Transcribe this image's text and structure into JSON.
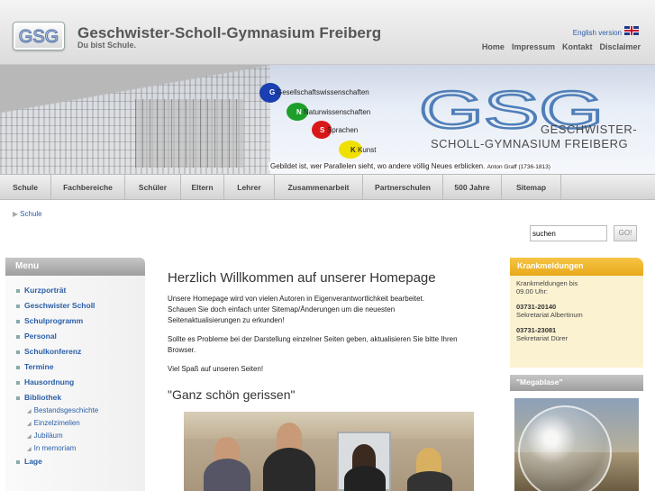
{
  "header": {
    "logo_text": "GSG",
    "title": "Geschwister-Scholl-Gymnasium Freiberg",
    "subtitle": "Du bist Schule.",
    "english_link": "English version",
    "top_links": [
      "Home",
      "Impressum",
      "Kontakt",
      "Disclaimer"
    ]
  },
  "banner": {
    "subjects": [
      "Gesellschaftswissenschaften",
      "Naturwissenschaften",
      "Sprachen",
      "Kunst"
    ],
    "subject_letters": [
      "G",
      "N",
      "S",
      "K"
    ],
    "subject_colors": [
      "#1a3fb0",
      "#1e9e2a",
      "#d81818",
      "#f0e000"
    ],
    "logo_letters": "GSG",
    "logo_line1": "GESCHWISTER-",
    "logo_line2": "SCHOLL-GYMNASIUM FREIBERG",
    "quote": "Gebildet ist, wer Parallelen sieht, wo andere völlig Neues erblicken.",
    "quote_author": "Anton Graff (1736-1813)"
  },
  "nav": [
    "Schule",
    "Fachbereiche",
    "Schüler",
    "Eltern",
    "Lehrer",
    "Zusammenarbeit",
    "Partnerschulen",
    "500 Jahre",
    "Sitemap"
  ],
  "breadcrumb": "Schule",
  "search": {
    "value": "suchen",
    "button": "GO!"
  },
  "menu": {
    "title": "Menu",
    "items": [
      "Kurzporträt",
      "Geschwister Scholl",
      "Schulprogramm",
      "Personal",
      "Schulkonferenz",
      "Termine",
      "Hausordnung",
      "Bibliothek"
    ],
    "subitems": [
      "Bestandsgeschichte",
      "Einzelzimelien",
      "Jubiläum",
      "In memoriam"
    ],
    "last_item": "Lage"
  },
  "main": {
    "title": "Herzlich Willkommen auf unserer Homepage",
    "para1_line1": "Unsere Homepage wird von vielen Autoren in Eigenverantwortlichkeit bearbeitet.",
    "para1_line2": "Schauen Sie doch einfach unter Sitemap/Änderungen um die neuesten",
    "para1_line3": "Seitenaktualisierungen zu erkunden!",
    "para2_line1": "Sollte es Probleme bei der Darstellung einzelner Seiten geben, aktualisieren Sie bitte Ihren",
    "para2_line2": "Browser.",
    "para3": "Viel Spaß auf unseren Seiten!",
    "subtitle": "\"Ganz schön gerissen\""
  },
  "krankmeldungen": {
    "title": "Krankmeldungen",
    "line1": "Krankmeldungen bis",
    "line2": "09.00 Uhr:",
    "phone1": "03731-20140",
    "place1": "Sekretariat Albertinum",
    "phone2": "03731-23081",
    "place2": "Sekretariat Dürer"
  },
  "megablase": {
    "title": "\"Megablase\""
  },
  "colors": {
    "link": "#2a5ea8",
    "accent": "#e8a81a",
    "menu_head": "#a8a8a8"
  }
}
